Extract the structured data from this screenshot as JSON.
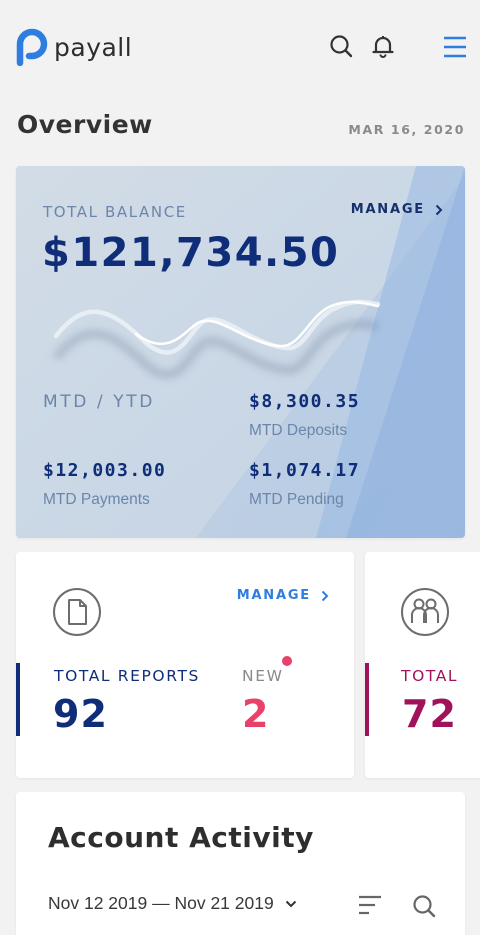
{
  "app": {
    "name": "payall"
  },
  "header": {
    "icons": [
      "search-icon",
      "bell-icon",
      "menu-icon"
    ]
  },
  "overview": {
    "title": "Overview",
    "date": "MAR 16, 2020"
  },
  "balance": {
    "label": "TOTAL BALANCE",
    "manage": "MANAGE",
    "amount": "$121,734.50",
    "period_label": "MTD / YTD",
    "stats": {
      "deposits": {
        "value": "$8,300.35",
        "label": "MTD Deposits"
      },
      "payments": {
        "value": "$12,003.00",
        "label": "MTD Payments"
      },
      "pending": {
        "value": "$1,074.17",
        "label": "MTD Pending"
      }
    }
  },
  "reports_card": {
    "icon": "document-icon",
    "manage": "MANAGE",
    "total_label": "TOTAL REPORTS",
    "total_value": "92",
    "new_label": "NEW",
    "new_value": "2"
  },
  "users_card": {
    "icon": "people-icon",
    "total_label": "TOTAL",
    "total_value": "72"
  },
  "activity": {
    "title": "Account Activity",
    "date_range": "Nov 12 2019 — Nov 21 2019"
  },
  "colors": {
    "brand_blue": "#2f7ddf",
    "navy": "#0f2d78",
    "pink": "#e8416a",
    "maroon": "#a0125a"
  }
}
